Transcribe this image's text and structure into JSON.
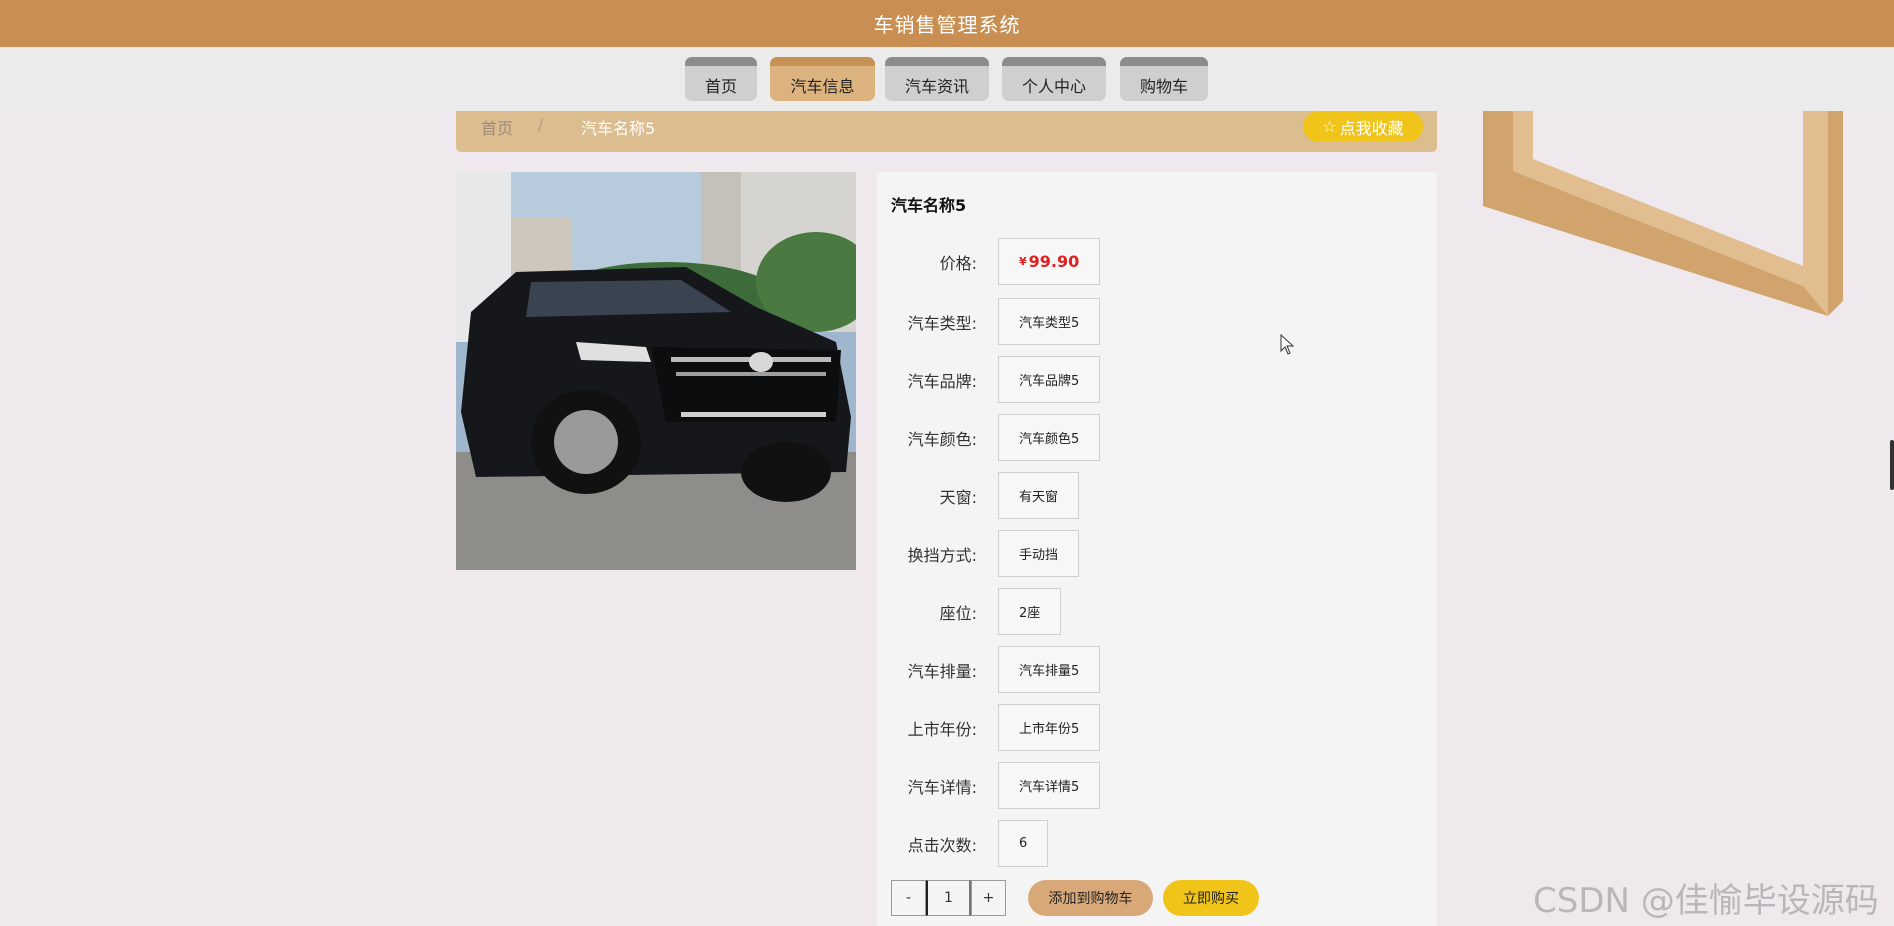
{
  "header": {
    "title": "车销售管理系统"
  },
  "nav": {
    "tabs": [
      {
        "label": "首页",
        "active": false
      },
      {
        "label": "汽车信息",
        "active": true
      },
      {
        "label": "汽车资讯",
        "active": false
      },
      {
        "label": "个人中心",
        "active": false
      },
      {
        "label": "购物车",
        "active": false
      }
    ]
  },
  "breadcrumb": {
    "home": "首页",
    "separator": "/",
    "current": "汽车名称5"
  },
  "favorite": {
    "label": "点我收藏"
  },
  "product": {
    "name": "汽车名称5",
    "price_symbol": "¥",
    "price": "99.90",
    "fields": [
      {
        "label": "价格:"
      },
      {
        "label": "汽车类型:",
        "value": "汽车类型5"
      },
      {
        "label": "汽车品牌:",
        "value": "汽车品牌5"
      },
      {
        "label": "汽车颜色:",
        "value": "汽车颜色5"
      },
      {
        "label": "天窗:",
        "value": "有天窗"
      },
      {
        "label": "换挡方式:",
        "value": "手动挡"
      },
      {
        "label": "座位:",
        "value": "2座"
      },
      {
        "label": "汽车排量:",
        "value": "汽车排量5"
      },
      {
        "label": "上市年份:",
        "value": "上市年份5"
      },
      {
        "label": "汽车详情:",
        "value": "汽车详情5"
      },
      {
        "label": "点击次数:",
        "value": "6"
      }
    ]
  },
  "quantity": {
    "minus": "-",
    "value": "1",
    "plus": "+"
  },
  "actions": {
    "add_to_cart": "添加到购物车",
    "buy_now": "立即购买"
  },
  "watermark": "CSDN @佳愉毕设源码",
  "colors": {
    "header": "#c98f52",
    "active_tab": "#dcb27f",
    "breadcrumb_bar": "#dcbd8f",
    "favorite": "#f0c418",
    "price": "#e02020"
  }
}
